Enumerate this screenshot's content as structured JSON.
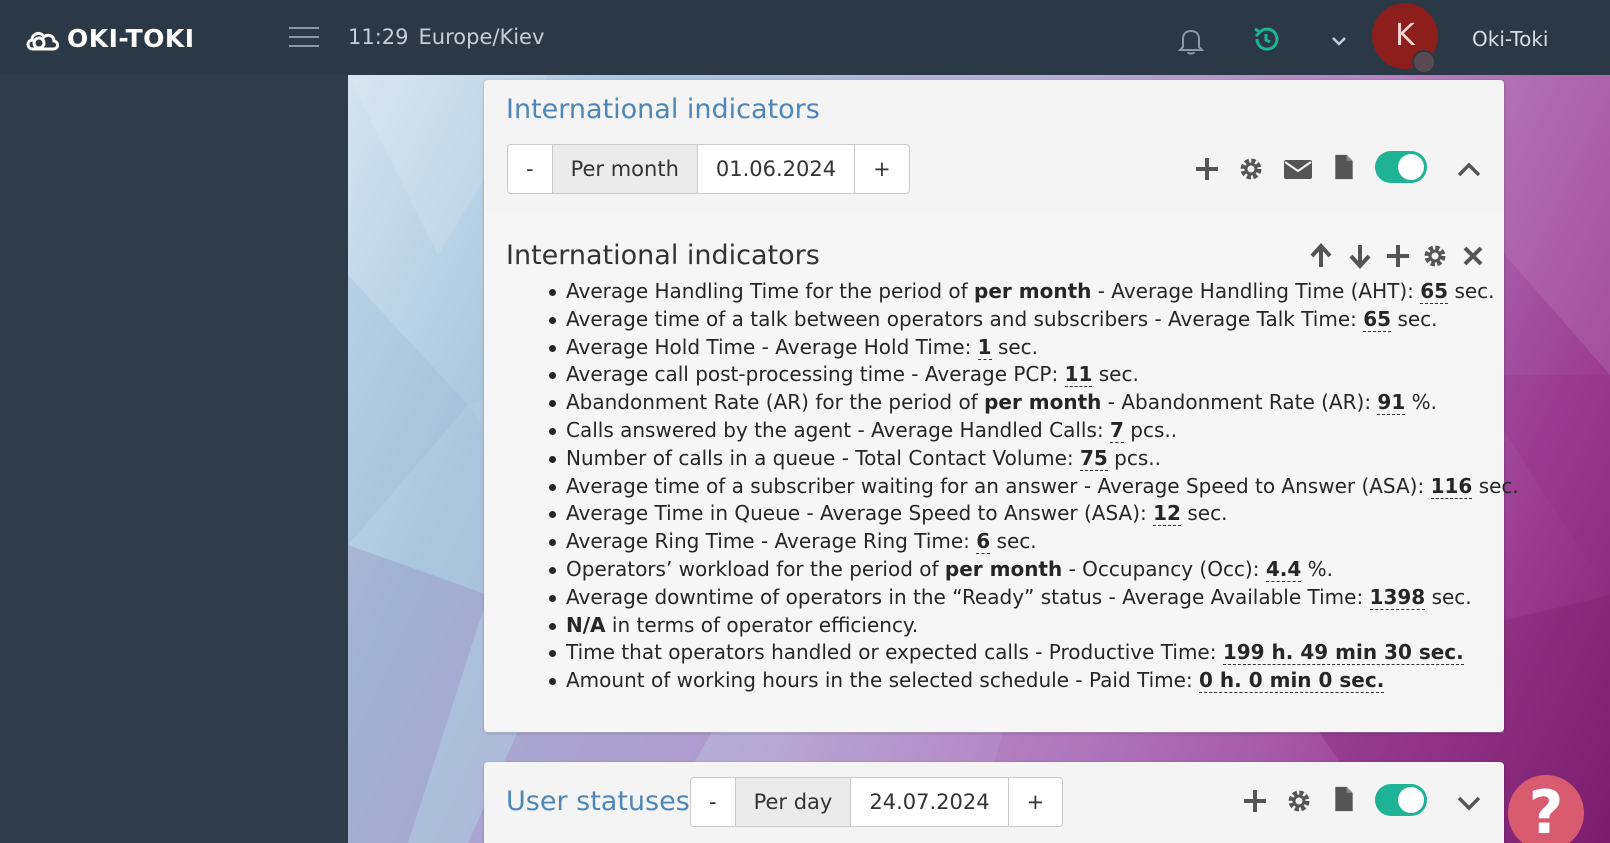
{
  "header": {
    "logo_text": "OKI-TOKI",
    "time": "11:29",
    "timezone": "Europe/Kiev",
    "avatar_letter": "K",
    "username": "Oki-Toki",
    "avatar_color": "#8c1f1c"
  },
  "panel1": {
    "title": "International indicators",
    "minus": "-",
    "mode": "Per month",
    "date": "01.06.2024",
    "plus": "+",
    "toggle_on": true
  },
  "widget": {
    "title": "International indicators",
    "items": [
      {
        "pre": "Average Handling Time for the period of ",
        "bold": "per month",
        "mid": " - Average Handling Time (AHT): ",
        "value": "65",
        "unit": " sec."
      },
      {
        "pre": "Average time of a talk between operators and subscribers - Average Talk Time: ",
        "bold": "",
        "mid": "",
        "value": "65",
        "unit": " sec."
      },
      {
        "pre": "Average Hold Time - Average Hold Time: ",
        "bold": "",
        "mid": "",
        "value": "1",
        "unit": " sec."
      },
      {
        "pre": "Average call post-processing time - Average PCP: ",
        "bold": "",
        "mid": "",
        "value": "11",
        "unit": " sec."
      },
      {
        "pre": "Abandonment Rate (AR) for the period of ",
        "bold": "per month",
        "mid": " - Abandonment Rate (AR): ",
        "value": "91",
        "unit": " %."
      },
      {
        "pre": "Calls answered by the agent - Average Handled Calls: ",
        "bold": "",
        "mid": "",
        "value": "7",
        "unit": " pcs.."
      },
      {
        "pre": "Number of calls in a queue - Total Contact Volume: ",
        "bold": "",
        "mid": "",
        "value": "75",
        "unit": " pcs.."
      },
      {
        "pre": "Average time of a subscriber waiting for an answer - Average Speed to Answer (ASA): ",
        "bold": "",
        "mid": "",
        "value": "116",
        "unit": " sec."
      },
      {
        "pre": "Average Time in Queue - Average Speed to Answer (ASA): ",
        "bold": "",
        "mid": "",
        "value": "12",
        "unit": " sec."
      },
      {
        "pre": "Average Ring Time - Average Ring Time: ",
        "bold": "",
        "mid": "",
        "value": "6",
        "unit": " sec."
      },
      {
        "pre": "Operators’ workload for the period of ",
        "bold": "per month",
        "mid": " - Occupancy (Occ): ",
        "value": "4.4",
        "unit": " %."
      },
      {
        "pre": "Average downtime of operators in the “Ready” status - Average Available Time: ",
        "bold": "",
        "mid": "",
        "value": "1398",
        "unit": " sec."
      },
      {
        "pre": "",
        "bold": "N/A",
        "mid": " in terms of operator efficiency.",
        "value": "",
        "unit": ""
      },
      {
        "pre": "Time that operators handled or expected calls - Productive Time: ",
        "bold": "",
        "mid": "",
        "value": "199 h. 49 min 30 sec.",
        "unit": ""
      },
      {
        "pre": "Amount of working hours in the selected schedule - Paid Time: ",
        "bold": "",
        "mid": "",
        "value": "0 h. 0 min 0 sec.",
        "unit": ""
      }
    ]
  },
  "panel2": {
    "title": "User statuses",
    "minus": "-",
    "mode": "Per day",
    "date": "24.07.2024",
    "plus": "+",
    "toggle_on": true
  },
  "help": {
    "symbol": "?"
  },
  "colors": {
    "accent": "#1db394",
    "title": "#4f86b8",
    "header_bg": "#2b3846"
  }
}
